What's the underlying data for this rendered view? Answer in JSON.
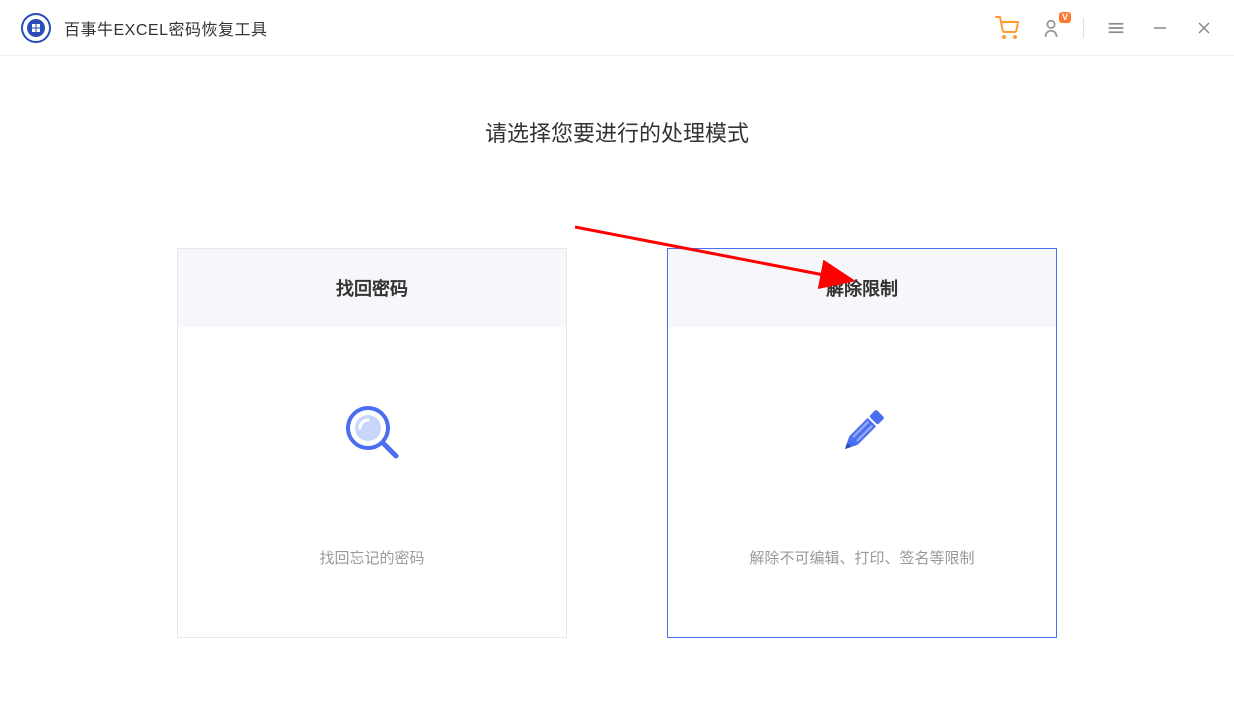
{
  "app": {
    "title": "百事牛EXCEL密码恢复工具"
  },
  "titlebar": {
    "user_badge": "V"
  },
  "main": {
    "heading": "请选择您要进行的处理模式"
  },
  "cards": [
    {
      "title": "找回密码",
      "desc": "找回忘记的密码",
      "selected": false
    },
    {
      "title": "解除限制",
      "desc": "解除不可编辑、打印、签名等限制",
      "selected": true
    }
  ],
  "colors": {
    "accent": "#4a6ef0",
    "orange": "#ff9a2d",
    "arrow": "#ff0000"
  }
}
